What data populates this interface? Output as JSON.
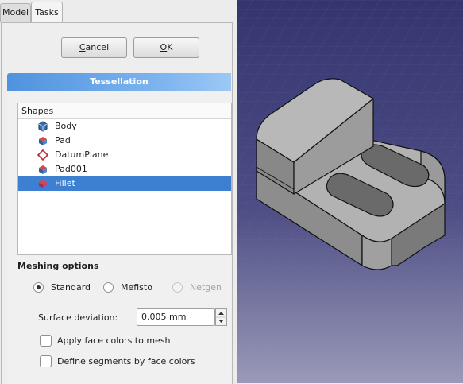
{
  "tabs": [
    {
      "label": "Model"
    },
    {
      "label": "Tasks"
    }
  ],
  "buttons": {
    "cancel": {
      "mnemonic": "C",
      "rest": "ancel"
    },
    "ok": {
      "mnemonic": "O",
      "rest": "K"
    }
  },
  "tessellation": {
    "title": "Tessellation",
    "shapes_header": "Shapes",
    "shapes": [
      {
        "label": "Body",
        "icon": "body-icon",
        "selected": false
      },
      {
        "label": "Pad",
        "icon": "pad-icon",
        "selected": false
      },
      {
        "label": "DatumPlane",
        "icon": "datum-plane-icon",
        "selected": false
      },
      {
        "label": "Pad001",
        "icon": "pad-icon",
        "selected": false
      },
      {
        "label": "Fillet",
        "icon": "fillet-icon",
        "selected": true
      }
    ]
  },
  "meshing": {
    "title": "Meshing options",
    "options": [
      {
        "label": "Standard",
        "checked": true,
        "disabled": false
      },
      {
        "label": "Mefisto",
        "checked": false,
        "disabled": false
      },
      {
        "label": "Netgen",
        "checked": false,
        "disabled": true
      }
    ],
    "surface_deviation_label": "Surface deviation:",
    "surface_deviation_value": "0.005 mm",
    "apply_face_colors": "Apply face colors to mesh",
    "define_segments": "Define segments by face colors"
  },
  "colors": {
    "header_accent": "#4f93de",
    "selection": "#3d80d2",
    "viewport_bg_top": "#3a3a78",
    "model_gray": "#a9a9a9"
  }
}
